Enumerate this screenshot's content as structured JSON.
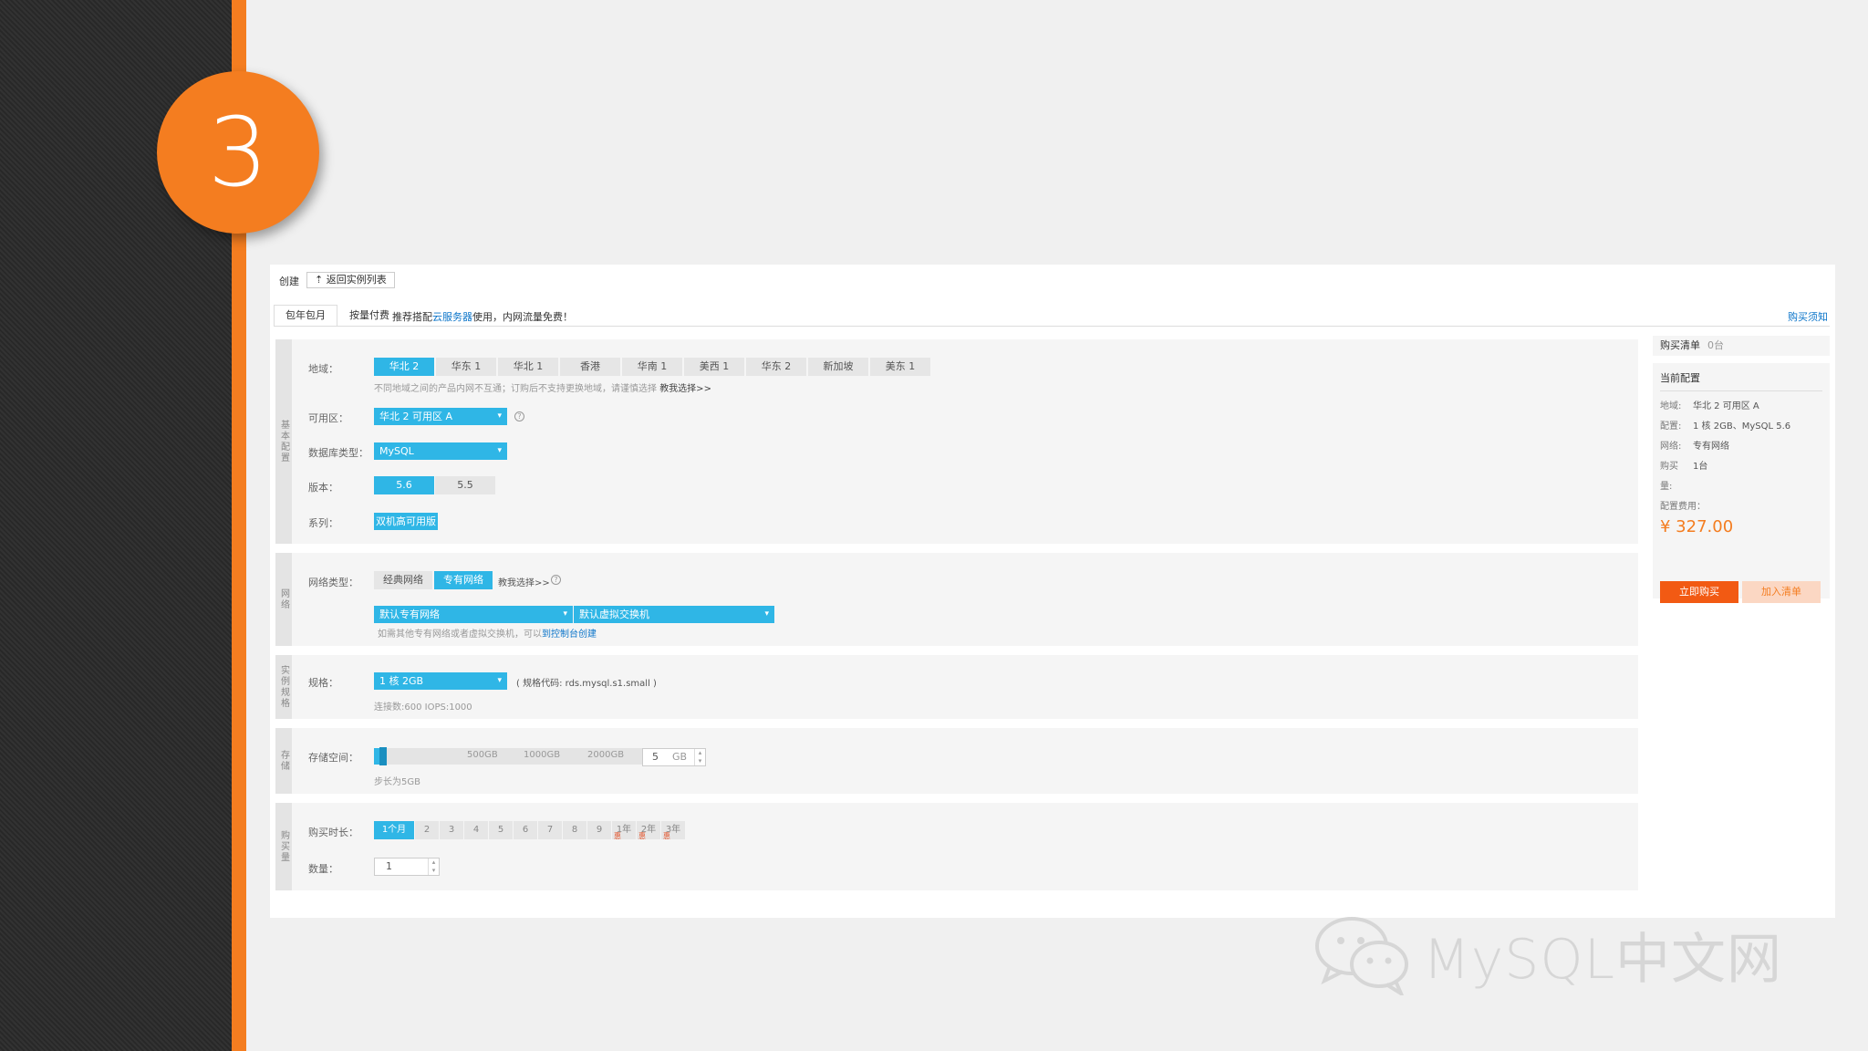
{
  "slide": {
    "step_number": "3",
    "watermark": "MySQL中文网"
  },
  "header": {
    "title": "创建",
    "back_button": "返回实例列表"
  },
  "tabs": [
    {
      "label": "包年包月",
      "active": true
    },
    {
      "label": "按量付费",
      "active": false
    }
  ],
  "promo": {
    "prefix": "推荐搭配",
    "link": "云服务器",
    "suffix": "使用，内网流量免费！"
  },
  "buy_notice": "购买须知",
  "sections": {
    "basic": {
      "bar_label": "基本配置",
      "region": {
        "label": "地域：",
        "options": [
          "华北 2",
          "华东 1",
          "华北 1",
          "香港",
          "华南 1",
          "美西 1",
          "华东 2",
          "新加坡",
          "美东 1"
        ],
        "selected": "华北 2",
        "hint": "不同地域之间的产品内网不互通；订购后不支持更换地域，请谨慎选择",
        "hint_link": "教我选择>>"
      },
      "zone": {
        "label": "可用区：",
        "value": "华北 2 可用区 A"
      },
      "db_type": {
        "label": "数据库类型：",
        "value": "MySQL"
      },
      "version": {
        "label": "版本：",
        "options": [
          "5.6",
          "5.5"
        ],
        "selected": "5.6"
      },
      "series": {
        "label": "系列：",
        "value": "双机高可用版"
      }
    },
    "network": {
      "bar_label": "网络",
      "type": {
        "label": "网络类型：",
        "options": [
          "经典网络",
          "专有网络"
        ],
        "selected": "专有网络",
        "help_link": "教我选择>>"
      },
      "vpc": "默认专有网络",
      "vswitch": "默认虚拟交换机",
      "hint": "如需其他专有网络或者虚拟交换机，可以",
      "hint_link": "到控制台创建"
    },
    "spec": {
      "bar_label": "实例规格",
      "label": "规格：",
      "value": "1 核 2GB",
      "code": "( 规格代码: rds.mysql.s1.small )",
      "detail": "连接数:600 IOPS:1000"
    },
    "storage": {
      "bar_label": "存储",
      "label": "存储空间：",
      "ticks": [
        "500GB",
        "1000GB",
        "2000GB"
      ],
      "value": "5",
      "unit": "GB",
      "fill_fraction": 0.01,
      "hint": "步长为5GB"
    },
    "purchase": {
      "bar_label": "购买量",
      "duration_label": "购买时长：",
      "durations": [
        "1个月",
        "2",
        "3",
        "4",
        "5",
        "6",
        "7",
        "8",
        "9",
        "1年",
        "2年",
        "3年"
      ],
      "discount_badges": {
        "9": "惠",
        "10": "惠",
        "11": "惠"
      },
      "selected": "1个月",
      "quantity_label": "数量：",
      "quantity": "1"
    }
  },
  "side": {
    "cart_label": "购买清单",
    "cart_count": "0台",
    "current_title": "当前配置",
    "config": [
      {
        "k": "地域:",
        "v": "华北 2 可用区 A"
      },
      {
        "k": "配置:",
        "v": "1 核 2GB、MySQL 5.6"
      },
      {
        "k": "网络:",
        "v": "专有网络"
      },
      {
        "k": "购买",
        "v": "1台"
      },
      {
        "k": "量:",
        "v": ""
      },
      {
        "k": "配置费用：",
        "v": ""
      }
    ],
    "price": "¥ 327.00",
    "buy_now": "立即购买",
    "add_to_cart": "加入清单"
  },
  "colors": {
    "accent": "#2fb6e6",
    "orange": "#f47d20",
    "buy": "#f25a13",
    "link": "#0a74c9"
  }
}
